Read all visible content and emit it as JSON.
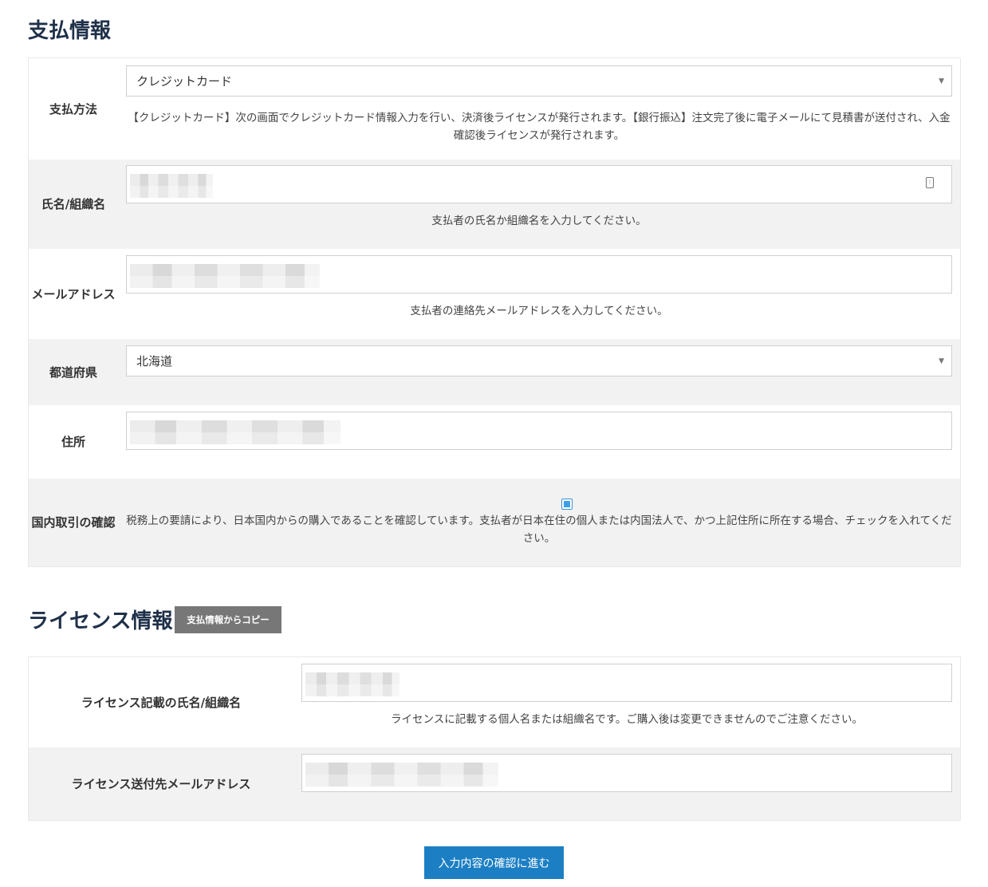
{
  "payment_section": {
    "title": "支払情報",
    "method": {
      "label": "支払方法",
      "selected": "クレジットカード",
      "help": "【クレジットカード】次の画面でクレジットカード情報入力を行い、決済後ライセンスが発行されます。【銀行振込】注文完了後に電子メールにて見積書が送付され、入金確認後ライセンスが発行されます。"
    },
    "name": {
      "label": "氏名/組織名",
      "help": "支払者の氏名か組織名を入力してください。"
    },
    "email": {
      "label": "メールアドレス",
      "help": "支払者の連絡先メールアドレスを入力してください。"
    },
    "prefecture": {
      "label": "都道府県",
      "selected": "北海道"
    },
    "address": {
      "label": "住所"
    },
    "domestic": {
      "label": "国内取引の確認",
      "checked": true,
      "help": "税務上の要請により、日本国内からの購入であることを確認しています。支払者が日本在住の個人または内国法人で、かつ上記住所に所在する場合、チェックを入れてください。"
    }
  },
  "license_section": {
    "title": "ライセンス情報",
    "copy_button": "支払情報からコピー",
    "name": {
      "label": "ライセンス記載の氏名/組織名",
      "help": "ライセンスに記載する個人名または組織名です。ご購入後は変更できませんのでご注意ください。"
    },
    "email": {
      "label": "ライセンス送付先メールアドレス"
    }
  },
  "submit_button": "入力内容の確認に進む",
  "colors": {
    "title": "#1f3049",
    "primary_button": "#1c7fc4",
    "secondary_button": "#777777",
    "alt_row": "#f2f2f2"
  }
}
